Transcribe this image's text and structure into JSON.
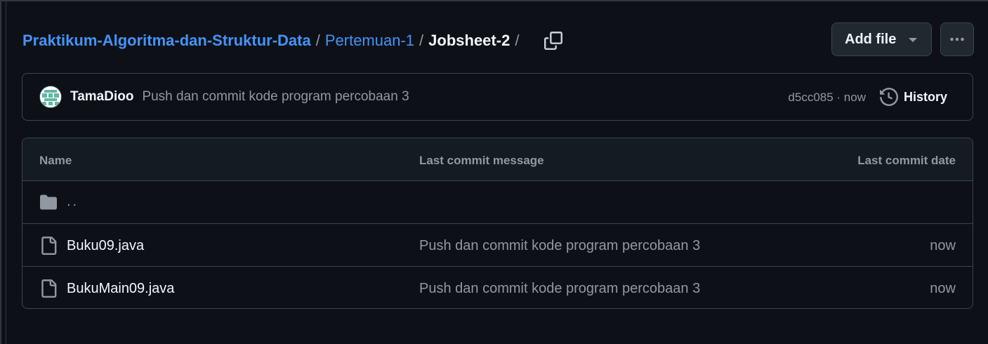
{
  "breadcrumb": {
    "repo": "Praktikum-Algoritma-dan-Struktur-Data",
    "folder": "Pertemuan-1",
    "current": "Jobsheet-2",
    "separator": "/"
  },
  "actions": {
    "add_file_label": "Add file",
    "more_icon": "kebab-horizontal-icon",
    "copy_icon": "copy-icon"
  },
  "latest_commit": {
    "author": "TamaDioo",
    "message": "Push dan commit kode program percobaan 3",
    "meta": "d5cc085 · now",
    "history_label": "History"
  },
  "table": {
    "headers": {
      "name": "Name",
      "message": "Last commit message",
      "date": "Last commit date"
    },
    "parent_dir": "..",
    "files": [
      {
        "name": "Buku09.java",
        "message": "Push dan commit kode program percobaan 3",
        "date": "now"
      },
      {
        "name": "BukuMain09.java",
        "message": "Push dan commit kode program percobaan 3",
        "date": "now"
      }
    ]
  },
  "colors": {
    "background": "#0d1117",
    "link": "#4493f8",
    "border": "#3d444d",
    "muted": "#9198a1"
  }
}
